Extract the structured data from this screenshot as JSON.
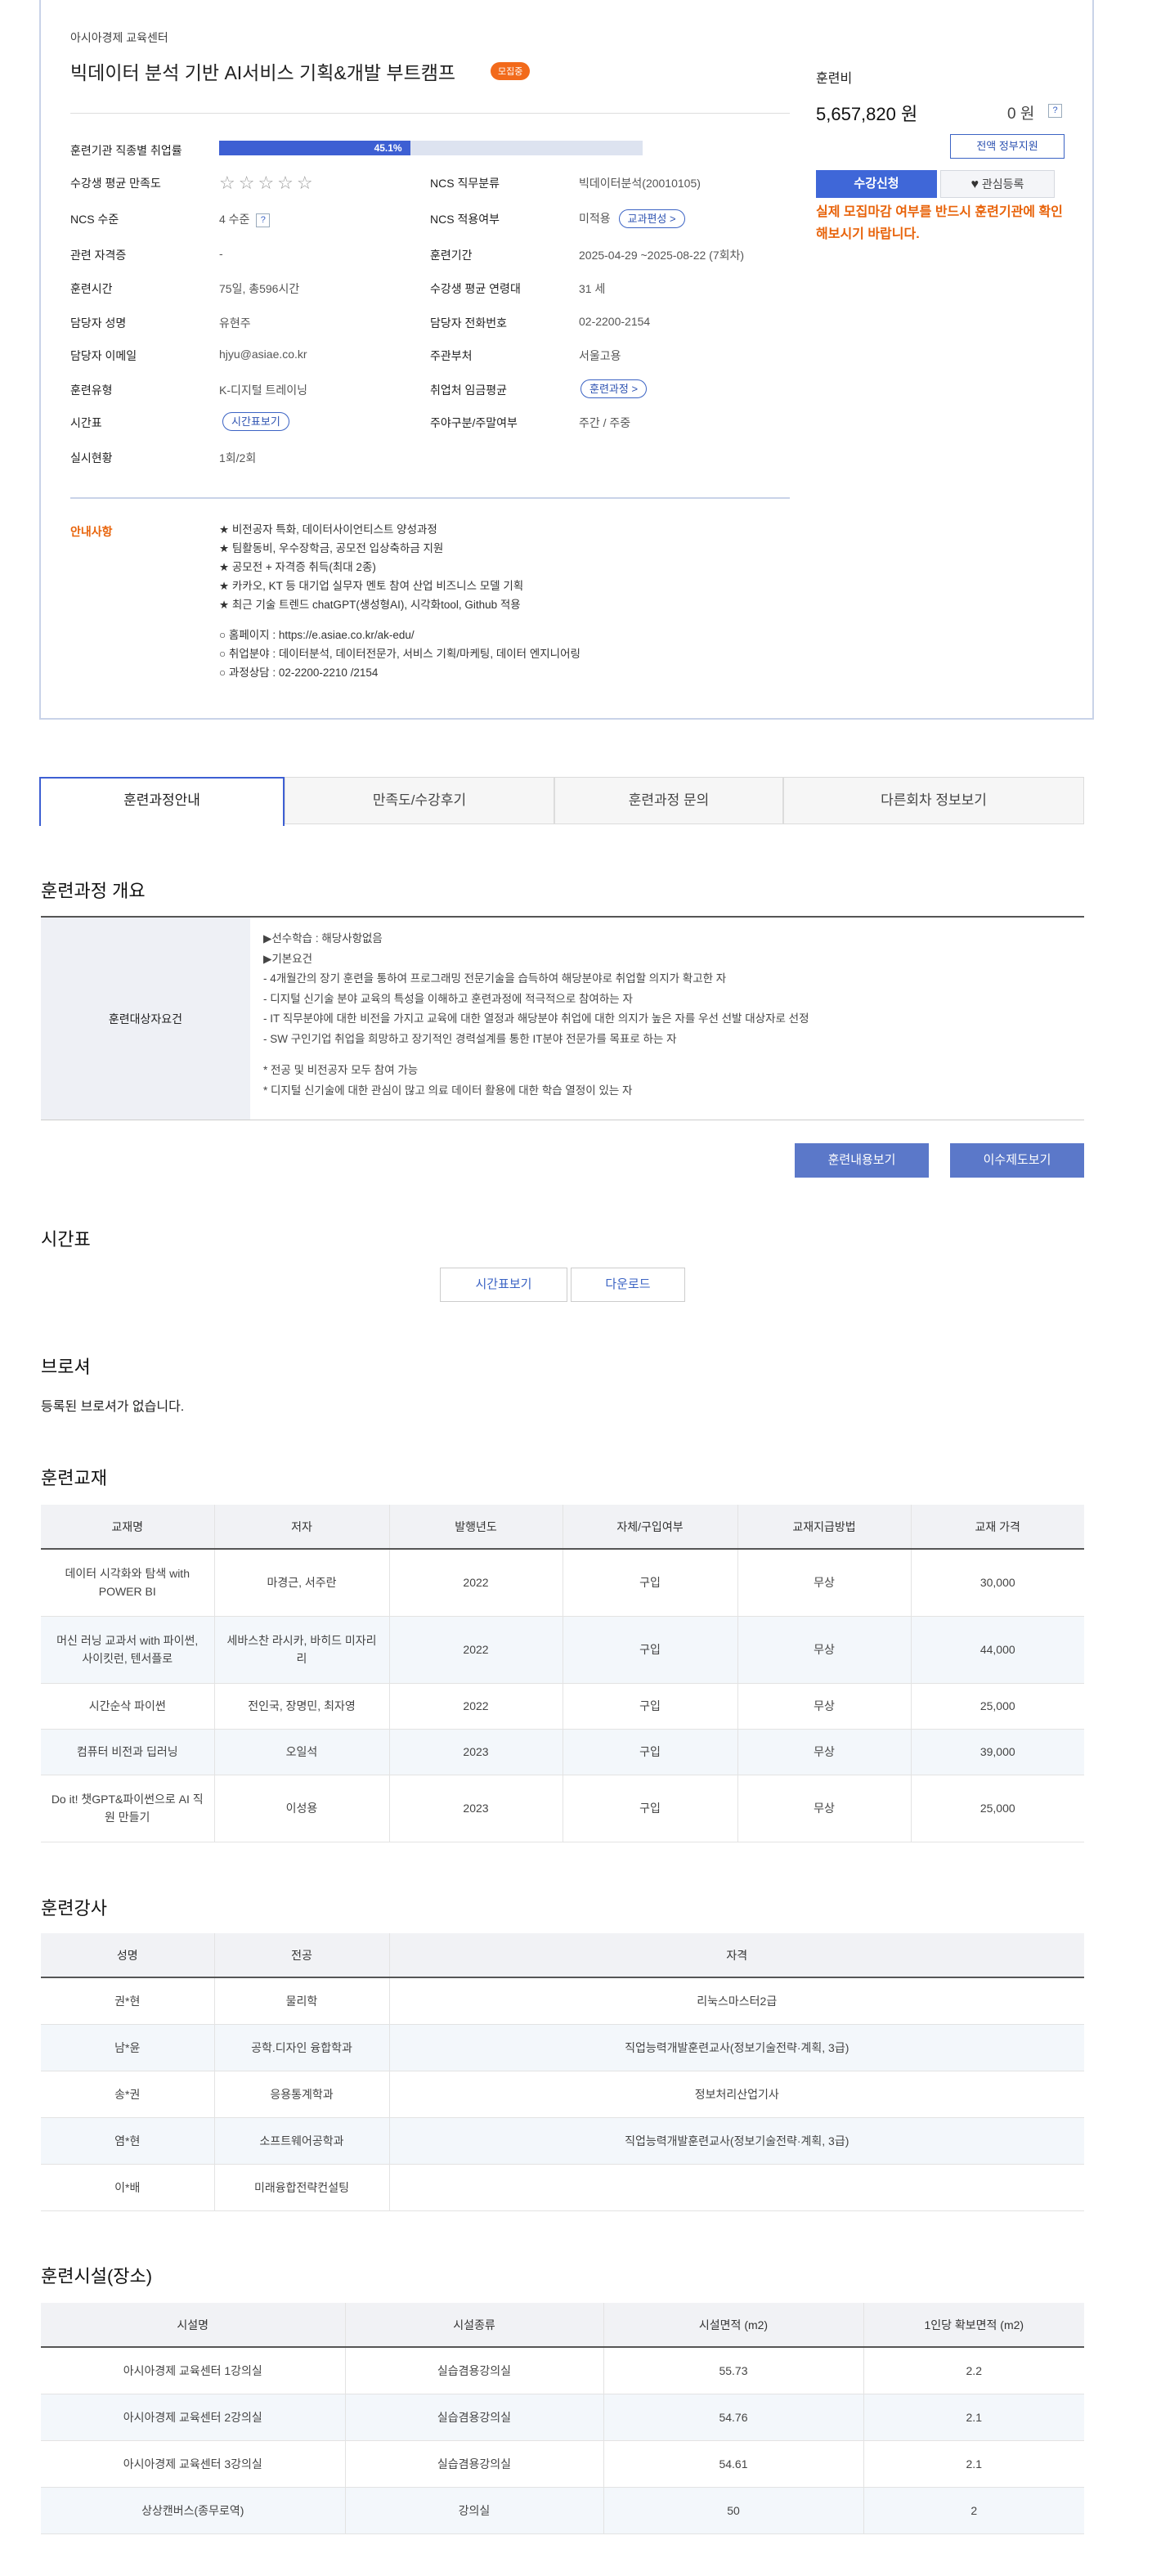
{
  "header": {
    "institution": "아시아경제 교육센터",
    "title": "빅데이터 분석 기반 AI서비스 기획&개발 부트캠프",
    "status_badge": "모집중"
  },
  "info": {
    "employment_rate_label": "훈련기관 직종별 취업률",
    "employment_rate_text": "45.1%",
    "employment_rate_value": 45.1,
    "satisfaction_label": "수강생 평균 만족도",
    "satisfaction_stars": "☆☆☆☆☆",
    "ncs_category_label": "NCS 직무분류",
    "ncs_category_value": "빅데이터분석(20010105)",
    "ncs_level_label": "NCS 수준",
    "ncs_level_value": "4 수준",
    "ncs_apply_label": "NCS 적용여부",
    "ncs_apply_value": "미적용",
    "curriculum_btn": "교과편성 >",
    "cert_label": "관련 자격증",
    "cert_value": "-",
    "period_label": "훈련기간",
    "period_value": "2025-04-29 ~2025-08-22 (7회차)",
    "hours_label": "훈련시간",
    "hours_value": "75일, 총596시간",
    "age_label": "수강생 평균 연령대",
    "age_value": "31 세",
    "manager_label": "담당자 성명",
    "manager_value": "유현주",
    "phone_label": "담당자 전화번호",
    "phone_value": "02-2200-2154",
    "email_label": "담당자 이메일",
    "email_value": "hjyu@asiae.co.kr",
    "dept_label": "주관부처",
    "dept_value": "서울고용",
    "type_label": "훈련유형",
    "type_value": "K-디지털 트레이닝",
    "wage_label": "취업처 임금평균",
    "wage_btn": "훈련과정 >",
    "timetable_label": "시간표",
    "timetable_btn": "시간표보기",
    "daynight_label": "주야구분/주말여부",
    "daynight_value": "주간 / 주중",
    "sessions_label": "실시현황",
    "sessions_value": "1회/2회",
    "q_mark": "?"
  },
  "notice": {
    "label": "안내사항",
    "lines": [
      "★ 비전공자 특화, 데이터사이언티스트 양성과정",
      "★ 팀활동비, 우수장학금, 공모전 입상축하금 지원",
      "★ 공모전 + 자격증 취득(최대 2종)",
      "★ 카카오, KT 등 대기업 실무자 멘토 참여 산업 비즈니스 모델 기획",
      "★ 최근 기술 트렌드 chatGPT(생성형AI), 시각화tool, Github 적용",
      "",
      "○ 홈페이지 : https://e.asiae.co.kr/ak-edu/",
      "○ 취업분야 : 데이터분석, 데이터전문가, 서비스 기획/마케팅, 데이터 엔지니어링",
      "○ 과정상담 : 02-2200-2210 /2154"
    ]
  },
  "price": {
    "label": "훈련비",
    "amount": "5,657,820 원",
    "self_pay": "0 원",
    "support_btn": "전액 정부지원",
    "apply_btn": "수강신청",
    "wish_btn": "관심등록",
    "heart_icon": "♥",
    "warning": "실제 모집마감 여부를 반드시 훈련기관에 확인해보시기 바랍니다."
  },
  "tabs": [
    {
      "label": "훈련과정안내"
    },
    {
      "label": "만족도/수강후기"
    },
    {
      "label": "훈련과정 문의"
    },
    {
      "label": "다른회차 정보보기"
    }
  ],
  "overview": {
    "title": "훈련과정 개요",
    "target_label": "훈련대상자요건",
    "lines": [
      "▶선수학습 : 해당사항없음",
      "▶기본요건",
      "- 4개월간의 장기 훈련을 통하여 프로그래밍 전문기술을 습득하여 해당분야로 취업할 의지가 확고한 자",
      "- 디지털 신기술 분야 교육의 특성을 이해하고 훈련과정에 적극적으로 참여하는 자",
      "- IT 직무분야에 대한 비전을 가지고 교육에 대한 열정과 해당분야 취업에 대한 의지가 높은 자를 우선 선발 대상자로 선정",
      "- SW 구인기업 취업을 희망하고 장기적인 경력설계를 통한 IT분야 전문가를 목표로 하는 자",
      "",
      "* 전공 및 비전공자 모두 참여 가능",
      "* 디지털 신기술에 대한 관심이 많고 의료 데이터 활용에 대한 학습 열정이 있는 자"
    ],
    "btn_content": "훈련내용보기",
    "btn_completion": "이수제도보기"
  },
  "timetable": {
    "title": "시간표",
    "btn_view": "시간표보기",
    "btn_download": "다운로드"
  },
  "brochure": {
    "title": "브로셔",
    "empty": "등록된 브로셔가 없습니다."
  },
  "textbooks": {
    "title": "훈련교재",
    "headers": [
      "교재명",
      "저자",
      "발행년도",
      "자체/구입여부",
      "교재지급방법",
      "교재 가격"
    ],
    "rows": [
      [
        "데이터 시각화와 탐색 with POWER BI",
        "마경근, 서주란",
        "2022",
        "구입",
        "무상",
        "30,000"
      ],
      [
        "머신 러닝 교과서 with 파이썬, 사이킷런, 텐서플로",
        "세바스찬 라시카, 바히드 미자리리",
        "2022",
        "구입",
        "무상",
        "44,000"
      ],
      [
        "시간순삭 파이썬",
        "전인국, 장명민, 최자영",
        "2022",
        "구입",
        "무상",
        "25,000"
      ],
      [
        "컴퓨터 비전과 딥러닝",
        "오일석",
        "2023",
        "구입",
        "무상",
        "39,000"
      ],
      [
        "Do it! 챗GPT&파이썬으로 AI 직원 만들기",
        "이성용",
        "2023",
        "구입",
        "무상",
        "25,000"
      ]
    ]
  },
  "instructors": {
    "title": "훈련강사",
    "headers": [
      "성명",
      "전공",
      "자격"
    ],
    "rows": [
      [
        "권*현",
        "물리학",
        "리눅스마스터2급"
      ],
      [
        "남*윤",
        "공학.디자인 융합학과",
        "직업능력개발훈련교사(정보기술전략·계획, 3급)"
      ],
      [
        "송*권",
        "응용통계학과",
        "정보처리산업기사"
      ],
      [
        "염*현",
        "소프트웨어공학과",
        "직업능력개발훈련교사(정보기술전략·계획, 3급)"
      ],
      [
        "이*배",
        "미래융합전략컨설팅",
        ""
      ]
    ]
  },
  "facilities": {
    "title": "훈련시설(장소)",
    "headers": [
      "시설명",
      "시설종류",
      "시설면적 (m2)",
      "1인당 확보면적 (m2)"
    ],
    "rows": [
      [
        "아시아경제 교육센터 1강의실",
        "실습겸용강의실",
        "55.73",
        "2.2"
      ],
      [
        "아시아경제 교육센터 2강의실",
        "실습겸용강의실",
        "54.76",
        "2.1"
      ],
      [
        "아시아경제 교육센터 3강의실",
        "실습겸용강의실",
        "54.61",
        "2.1"
      ],
      [
        "상상캔버스(종무로역)",
        "강의실",
        "50",
        "2"
      ]
    ]
  }
}
